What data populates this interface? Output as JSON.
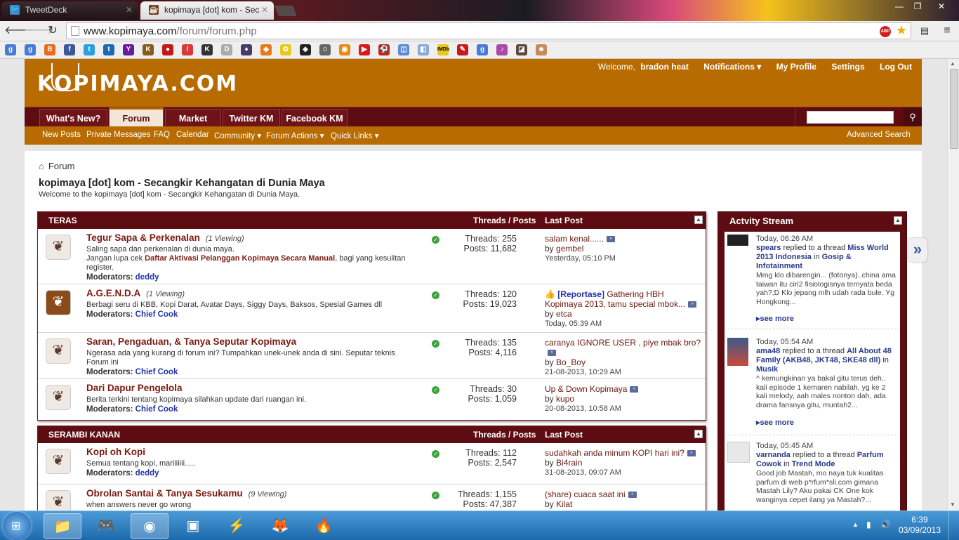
{
  "browser": {
    "tabs": [
      {
        "title": "TweetDeck"
      },
      {
        "title": "kopimaya [dot] kom - Sec"
      }
    ],
    "url_host": "www.kopimaya.com",
    "url_path": "/forum/forum.php",
    "abp_label": "ABP",
    "window_controls": {
      "minimize": "—",
      "restore": "❐",
      "close": "✕"
    }
  },
  "site": {
    "logo": "KOPIMAYA.COM",
    "user": {
      "welcome": "Welcome,",
      "username": "bradon heat",
      "notifications": "Notifications ▾",
      "profile": "My Profile",
      "settings": "Settings",
      "logout": "Log Out"
    },
    "nav_tabs": [
      "What's New?",
      "Forum",
      "Market",
      "Twitter KM",
      "Facebook KM"
    ],
    "subnav": [
      "New Posts",
      "Private Messages",
      "FAQ",
      "Calendar",
      "Community ▾",
      "Forum Actions ▾",
      "Quick Links ▾"
    ],
    "advanced_search": "Advanced Search"
  },
  "page": {
    "breadcrumb": "Forum",
    "title": "kopimaya [dot] kom - Secangkir Kehangatan di Dunia Maya",
    "description": "Welcome to the kopimaya [dot] kom - Secangkir Kehangatan di Dunia Maya."
  },
  "sections": [
    {
      "name": "TERAS",
      "col_threads_posts": "Threads / Posts",
      "col_last_post": "Last Post",
      "forums": [
        {
          "title": "Tegur Sapa & Perkenalan",
          "viewing": "(1 Viewing)",
          "desc1": "Saling sapa dan perkenalan di dunia maya.",
          "desc2a": "Jangan lupa cek ",
          "desc2b": "Daftar Aktivasi Pelanggan Kopimaya Secara Manual",
          "desc2c": ", bagi yang kesulitan register.",
          "mods_label": "Moderators:",
          "mods": "deddy",
          "threads": "Threads: 255",
          "posts": "Posts: 11,682",
          "last_title": "salam kenal......",
          "last_by_label": "by",
          "last_by": "gembel",
          "last_time": "Yesterday, 05:10 PM"
        },
        {
          "title": "A.G.E.N.D.A",
          "viewing": "(1 Viewing)",
          "desc1": "Berbagi seru di KBB, Kopi Darat, Avatar Days, Siggy Days, Baksos, Spesial Games dll",
          "mods_label": "Moderators:",
          "mods": "Chief Cook",
          "threads": "Threads: 120",
          "posts": "Posts: 19,023",
          "last_tag": "[Reportase]",
          "last_title": " Gathering HBH Kopimaya 2013, tamu special mbok...",
          "last_by_label": "by",
          "last_by": "etca",
          "last_time": "Today, 05:39 AM"
        },
        {
          "title": "Saran, Pengaduan, & Tanya Seputar Kopimaya",
          "desc1": "Ngerasa ada yang kurang di forum ini? Tumpahkan unek-unek anda di sini. Seputar teknis Forum ini",
          "mods_label": "Moderators:",
          "mods": "Chief Cook",
          "threads": "Threads: 135",
          "posts": "Posts: 4,116",
          "last_title": "caranya IGNORE USER , piye mbak bro?",
          "last_by_label": "by",
          "last_by": "Bo_Boy",
          "last_time": "21-08-2013, 10:29 AM"
        },
        {
          "title": "Dari Dapur Pengelola",
          "desc1": "Berita terkini tentang kopimaya silahkan update dari ruangan ini.",
          "mods_label": "Moderators:",
          "mods": "Chief Cook",
          "threads": "Threads: 30",
          "posts": "Posts: 1,059",
          "last_title": "Up & Down Kopimaya",
          "last_by_label": "by",
          "last_by": "kupo",
          "last_time": "20-08-2013, 10:58 AM"
        }
      ]
    },
    {
      "name": "SERAMBI KANAN",
      "col_threads_posts": "Threads / Posts",
      "col_last_post": "Last Post",
      "forums": [
        {
          "title": "Kopi oh Kopi",
          "desc1": "Semua tentang kopi, mariiiiiii.....",
          "mods_label": "Moderators:",
          "mods": "deddy",
          "threads": "Threads: 112",
          "posts": "Posts: 2,547",
          "last_title": "sudahkah anda minum KOPI hari ini?",
          "last_by_label": "by",
          "last_by": "Bi4rain",
          "last_time": "31-08-2013, 09:07 AM"
        },
        {
          "title": "Obrolan Santai & Tanya Sesukamu",
          "viewing": "(9 Viewing)",
          "desc1": "when answers never go wrong",
          "threads": "Threads: 1,155",
          "posts": "Posts: 47,387",
          "last_title": "(share) cuaca saat ini",
          "last_by_label": "by",
          "last_by": "Kilat"
        }
      ]
    }
  ],
  "activity": {
    "title": "Actvity Stream",
    "see_more": "see more",
    "items": [
      {
        "time": "Today, 06:26 AM",
        "user": "spears",
        "verb": " replied to a thread ",
        "thread": "Miss World 2013 Indonesia",
        "in": " in ",
        "forum": "Gosip & Infotainment",
        "snippet": "Mmg klo dibarengin... (fotonya)..china ama taiwan itu ciri2 fisiologisnya ternyata beda yah?;D Klo jepang mlh udah rada bule. Yg Hongkong..."
      },
      {
        "time": "Today, 05:54 AM",
        "user": "ama48",
        "verb": " replied to a thread ",
        "thread": "All About 48 Family (AKB48, JKT48, SKE48 dll)",
        "in": " in ",
        "forum": "Musik",
        "snippet": "^ kemungkinan ya bakal gitu terus deh.. kali episode 1 kemaren nabilah, yg ke 2 kali melody, aah males nonton dah, ada drama fansnya gitu, muntah2..."
      },
      {
        "time": "Today, 05:45 AM",
        "user": "varnanda",
        "verb": " replied to a thread ",
        "thread": "Parfum Cowok",
        "in": " in ",
        "forum": "Trend Mode",
        "snippet": "Good job Mastah, mo naya tuk kualitas parfum di web p*rfum*sli.com gimana Mastah Lily? Aku pakai CK One kok wanginya cepet ilang ya Mastah?..."
      }
    ]
  },
  "taskbar": {
    "time": "6:39",
    "date": "03/09/2013"
  },
  "colors": {
    "header_orange": "#b86b00",
    "nav_maroon": "#5d0c12",
    "link_blue": "#2233aa",
    "title_red": "#7a1a10"
  }
}
